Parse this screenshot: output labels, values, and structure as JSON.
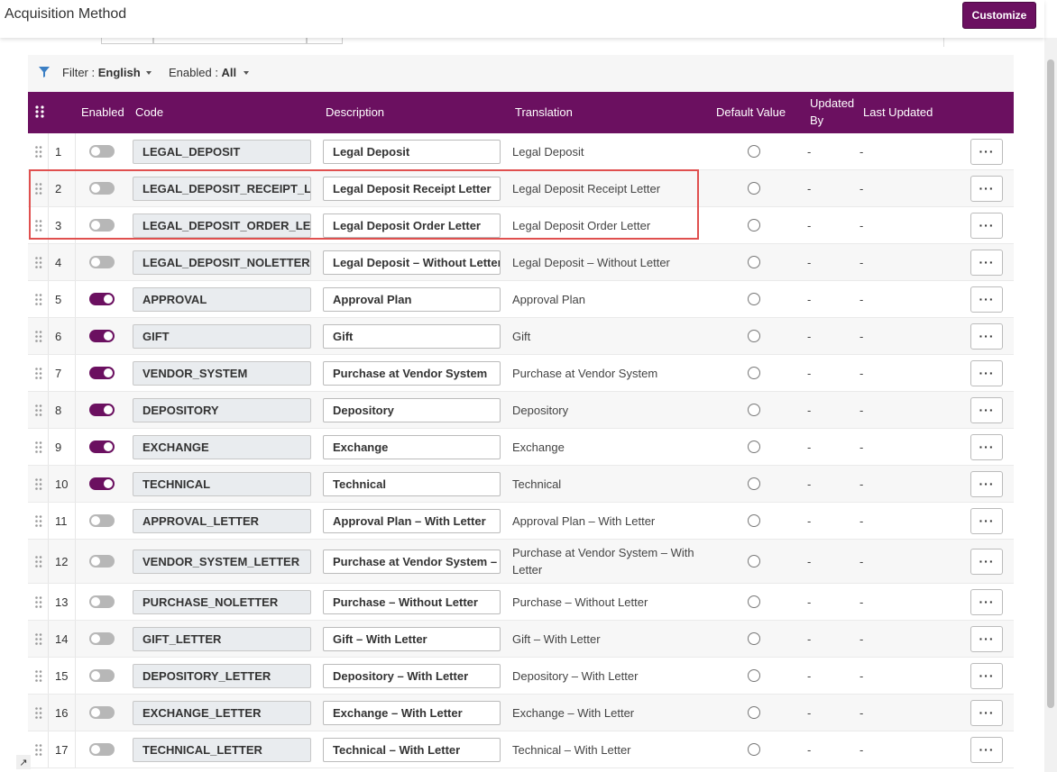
{
  "header": {
    "title": "Acquisition Method",
    "customize_label": "Customize"
  },
  "filters": {
    "language_label": "Filter : ",
    "language_value": "English",
    "enabled_label": "Enabled : ",
    "enabled_value": "All"
  },
  "columns": {
    "enabled": "Enabled",
    "code": "Code",
    "description": "Description",
    "translation": "Translation",
    "default_value": "Default Value",
    "updated_by_1": "Updated",
    "updated_by_2": "By",
    "last_updated": "Last Updated"
  },
  "colors": {
    "accent": "#6b1060",
    "highlight": "#e0504f"
  },
  "icons": {
    "filter": "filter-icon",
    "grip": "drag-handle-icon",
    "more": "more-actions-icon"
  },
  "rows": [
    {
      "num": "1",
      "enabled": false,
      "code": "LEGAL_DEPOSIT",
      "description": "Legal Deposit",
      "translation": "Legal Deposit",
      "updated_by": "-",
      "last_updated": "-"
    },
    {
      "num": "2",
      "enabled": false,
      "code": "LEGAL_DEPOSIT_RECEIPT_LETTER",
      "description": "Legal Deposit Receipt Letter",
      "translation": "Legal Deposit Receipt Letter",
      "updated_by": "-",
      "last_updated": "-"
    },
    {
      "num": "3",
      "enabled": false,
      "code": "LEGAL_DEPOSIT_ORDER_LETTER",
      "description": "Legal Deposit Order Letter",
      "translation": "Legal Deposit Order Letter",
      "updated_by": "-",
      "last_updated": "-"
    },
    {
      "num": "4",
      "enabled": false,
      "code": "LEGAL_DEPOSIT_NOLETTER",
      "description": "Legal Deposit – Without Letter",
      "translation": "Legal Deposit – Without Letter",
      "updated_by": "-",
      "last_updated": "-"
    },
    {
      "num": "5",
      "enabled": true,
      "code": "APPROVAL",
      "description": "Approval Plan",
      "translation": "Approval Plan",
      "updated_by": "-",
      "last_updated": "-"
    },
    {
      "num": "6",
      "enabled": true,
      "code": "GIFT",
      "description": "Gift",
      "translation": "Gift",
      "updated_by": "-",
      "last_updated": "-"
    },
    {
      "num": "7",
      "enabled": true,
      "code": "VENDOR_SYSTEM",
      "description": "Purchase at Vendor System",
      "translation": "Purchase at Vendor System",
      "updated_by": "-",
      "last_updated": "-"
    },
    {
      "num": "8",
      "enabled": true,
      "code": "DEPOSITORY",
      "description": "Depository",
      "translation": "Depository",
      "updated_by": "-",
      "last_updated": "-"
    },
    {
      "num": "9",
      "enabled": true,
      "code": "EXCHANGE",
      "description": "Exchange",
      "translation": "Exchange",
      "updated_by": "-",
      "last_updated": "-"
    },
    {
      "num": "10",
      "enabled": true,
      "code": "TECHNICAL",
      "description": "Technical",
      "translation": "Technical",
      "updated_by": "-",
      "last_updated": "-"
    },
    {
      "num": "11",
      "enabled": false,
      "code": "APPROVAL_LETTER",
      "description": "Approval Plan – With Letter",
      "translation": "Approval Plan – With Letter",
      "updated_by": "-",
      "last_updated": "-"
    },
    {
      "num": "12",
      "enabled": false,
      "code": "VENDOR_SYSTEM_LETTER",
      "description": "Purchase at Vendor System – With Letter",
      "translation": "Purchase at Vendor System – With Letter",
      "updated_by": "-",
      "last_updated": "-"
    },
    {
      "num": "13",
      "enabled": false,
      "code": "PURCHASE_NOLETTER",
      "description": "Purchase – Without Letter",
      "translation": "Purchase – Without Letter",
      "updated_by": "-",
      "last_updated": "-"
    },
    {
      "num": "14",
      "enabled": false,
      "code": "GIFT_LETTER",
      "description": "Gift – With Letter",
      "translation": "Gift – With Letter",
      "updated_by": "-",
      "last_updated": "-"
    },
    {
      "num": "15",
      "enabled": false,
      "code": "DEPOSITORY_LETTER",
      "description": "Depository – With Letter",
      "translation": "Depository – With Letter",
      "updated_by": "-",
      "last_updated": "-"
    },
    {
      "num": "16",
      "enabled": false,
      "code": "EXCHANGE_LETTER",
      "description": "Exchange – With Letter",
      "translation": "Exchange – With Letter",
      "updated_by": "-",
      "last_updated": "-"
    },
    {
      "num": "17",
      "enabled": false,
      "code": "TECHNICAL_LETTER",
      "description": "Technical – With Letter",
      "translation": "Technical – With Letter",
      "updated_by": "-",
      "last_updated": "-"
    }
  ]
}
